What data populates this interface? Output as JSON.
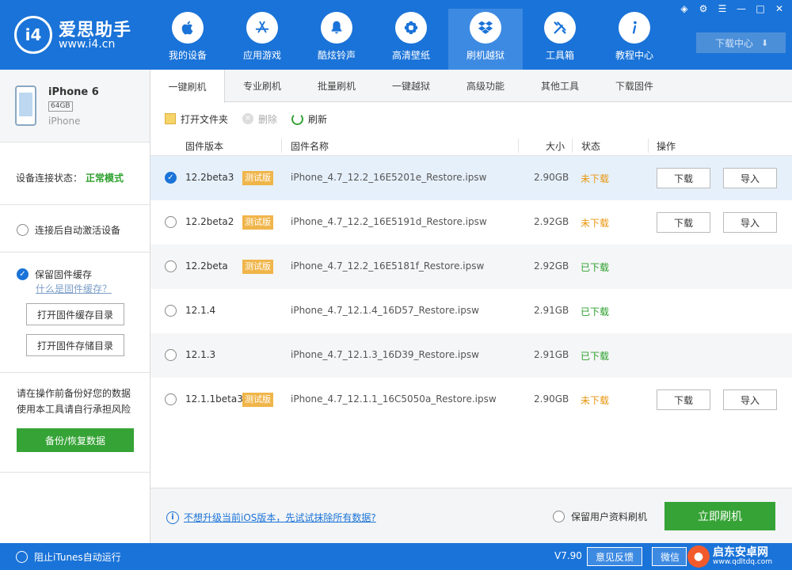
{
  "app": {
    "logo_mark": "i4",
    "logo_title": "爱思助手",
    "logo_url": "www.i4.cn"
  },
  "nav": [
    {
      "label": "我的设备",
      "icon": "apple-icon"
    },
    {
      "label": "应用游戏",
      "icon": "appstore-icon"
    },
    {
      "label": "酷炫铃声",
      "icon": "bell-icon"
    },
    {
      "label": "高清壁纸",
      "icon": "flower-icon"
    },
    {
      "label": "刷机越狱",
      "icon": "dropbox-icon",
      "active": true
    },
    {
      "label": "工具箱",
      "icon": "tools-icon"
    },
    {
      "label": "教程中心",
      "icon": "info-icon"
    }
  ],
  "download_center": "下载中心",
  "device": {
    "name": "iPhone 6",
    "capacity": "64GB",
    "model": "iPhone"
  },
  "sidebar": {
    "conn_label": "设备连接状态：",
    "conn_value": "正常模式",
    "auto_activate": "连接后自动激活设备",
    "keep_cache": "保留固件缓存",
    "what_cache": "什么是固件缓存？",
    "open_cache_dir": "打开固件缓存目录",
    "open_store_dir": "打开固件存储目录",
    "warn_line1": "请在操作前备份好您的数据",
    "warn_line2": "使用本工具请自行承担风险",
    "backup_button": "备份/恢复数据"
  },
  "tabs": [
    "一键刷机",
    "专业刷机",
    "批量刷机",
    "一键越狱",
    "高级功能",
    "其他工具",
    "下载固件"
  ],
  "toolbar": {
    "open_folder": "打开文件夹",
    "delete": "删除",
    "refresh": "刷新"
  },
  "table": {
    "headers": {
      "version": "固件版本",
      "name": "固件名称",
      "size": "大小",
      "status": "状态",
      "action": "操作"
    },
    "rows": [
      {
        "version": "12.2beta3",
        "beta": "测试版",
        "name": "iPhone_4.7_12.2_16E5201e_Restore.ipsw",
        "size": "2.90GB",
        "status": "未下载",
        "downloaded": false,
        "selected": true,
        "btn_download": "下载",
        "btn_import": "导入"
      },
      {
        "version": "12.2beta2",
        "beta": "测试版",
        "name": "iPhone_4.7_12.2_16E5191d_Restore.ipsw",
        "size": "2.92GB",
        "status": "未下载",
        "downloaded": false,
        "selected": false,
        "btn_download": "下载",
        "btn_import": "导入"
      },
      {
        "version": "12.2beta",
        "beta": "测试版",
        "name": "iPhone_4.7_12.2_16E5181f_Restore.ipsw",
        "size": "2.92GB",
        "status": "已下载",
        "downloaded": true,
        "selected": false
      },
      {
        "version": "12.1.4",
        "name": "iPhone_4.7_12.1.4_16D57_Restore.ipsw",
        "size": "2.91GB",
        "status": "已下载",
        "downloaded": true,
        "selected": false
      },
      {
        "version": "12.1.3",
        "name": "iPhone_4.7_12.1.3_16D39_Restore.ipsw",
        "size": "2.91GB",
        "status": "已下载",
        "downloaded": true,
        "selected": false
      },
      {
        "version": "12.1.1beta3",
        "beta": "测试版",
        "name": "iPhone_4.7_12.1.1_16C5050a_Restore.ipsw",
        "size": "2.90GB",
        "status": "未下载",
        "downloaded": false,
        "selected": false,
        "btn_download": "下载",
        "btn_import": "导入"
      }
    ]
  },
  "bottom": {
    "tip": "不想升级当前iOS版本，先试试抹除所有数据?",
    "keep_data": "保留用户资料刷机",
    "flash_button": "立即刷机"
  },
  "statusbar": {
    "itunes": "阻止iTunes自动运行",
    "version": "V7.90",
    "feedback": "意见反馈",
    "wechat": "微信"
  },
  "watermark": {
    "text": "启东安卓网",
    "url": "www.qdltdq.com"
  },
  "colors": {
    "brand_blue": "#1a73d8",
    "green": "#36a336",
    "beta_orange": "#f0b54a",
    "status_orange": "#e8960f"
  }
}
